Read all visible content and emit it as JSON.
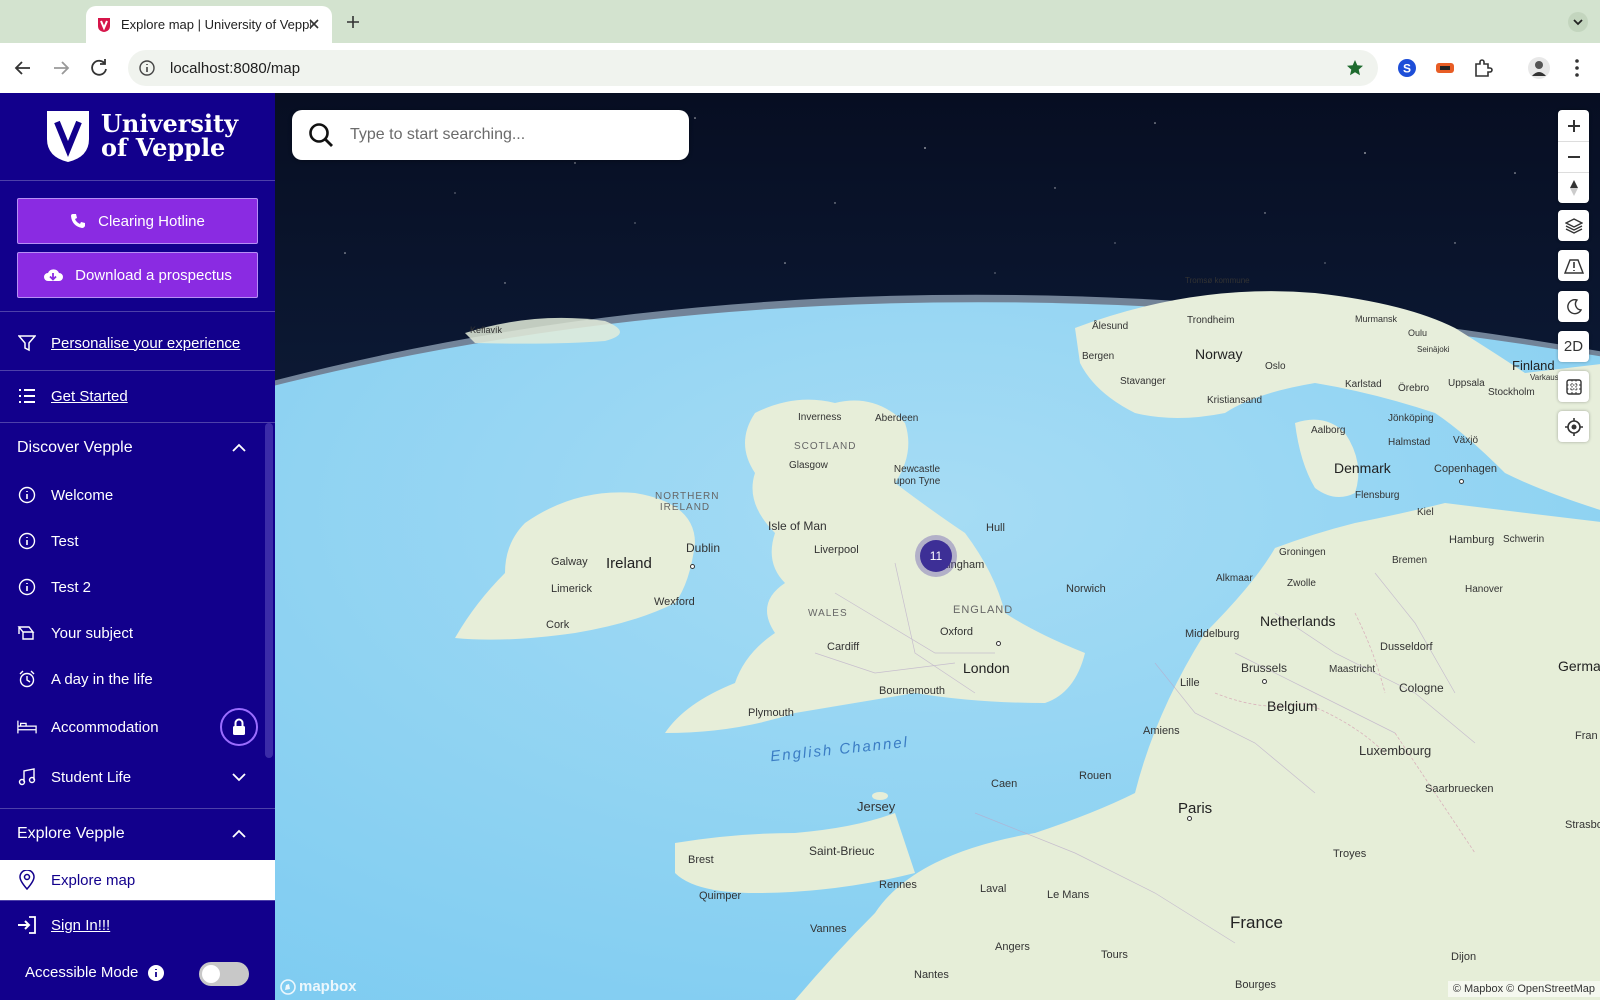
{
  "browser": {
    "tab_title": "Explore map | University of Vepple",
    "url": "localhost:8080/map"
  },
  "sidebar": {
    "logo_line1": "University",
    "logo_line2": "of Vepple",
    "clearing_hotline": "Clearing Hotline",
    "download_prospectus": "Download a prospectus",
    "personalise": "Personalise your experience",
    "get_started": "Get Started",
    "discover_heading": "Discover Vepple",
    "discover_items": [
      "Welcome",
      "Test",
      "Test 2",
      "Your subject",
      "A day in the life",
      "Accommodation",
      "Student Life"
    ],
    "explore_heading": "Explore Vepple",
    "explore_map": "Explore map",
    "sign_in": "Sign In!!!",
    "accessible_mode": "Accessible Mode",
    "accessible_mode_on": false
  },
  "map": {
    "search_placeholder": "Type to start searching...",
    "view_mode": "2D",
    "cluster_count": "11",
    "attribution": "© Mapbox © OpenStreetMap",
    "logo": "mapbox",
    "labels": {
      "keflavik": "Keflavík",
      "alesund": "Ålesund",
      "trondheim": "Trondheim",
      "tromso": "Tromsø kommune",
      "murmansk": "Murmansk",
      "oulu": "Oulu",
      "seinajoki": "Seinäjoki",
      "bergen": "Bergen",
      "norway": "Norway",
      "oslo": "Oslo",
      "stavanger": "Stavanger",
      "kristiansand": "Kristiansand",
      "karlstad": "Karlstad",
      "orebro": "Örebro",
      "uppsala": "Uppsala",
      "stockholm": "Stockholm",
      "finland": "Finland",
      "varkaus": "Varkaus",
      "jonkoping": "Jönköping",
      "aalborg": "Aalborg",
      "halmstad": "Halmstad",
      "vaxjo": "Växjö",
      "denmark": "Denmark",
      "copenhagen": "Copenhagen",
      "flensburg": "Flensburg",
      "kiel": "Kiel",
      "hamburg": "Hamburg",
      "schwerin": "Schwerin",
      "groningen": "Groningen",
      "bremen": "Bremen",
      "alkmaar": "Alkmaar",
      "zwolle": "Zwolle",
      "hanover": "Hanover",
      "netherlands": "Netherlands",
      "middelburg": "Middelburg",
      "dusseldorf": "Dusseldorf",
      "brussels": "Brussels",
      "maastricht": "Maastricht",
      "cologne": "Cologne",
      "germany": "Germa",
      "lille": "Lille",
      "belgium": "Belgium",
      "amiens": "Amiens",
      "luxembourg": "Luxembourg",
      "saarbrucken": "Saarbruecken",
      "frankfurt": "Fran",
      "strasbourg": "Strasbo",
      "rouen": "Rouen",
      "paris": "Paris",
      "caen": "Caen",
      "troyes": "Troyes",
      "inverness": "Inverness",
      "aberdeen": "Aberdeen",
      "scotland": "SCOTLAND",
      "glasgow": "Glasgow",
      "newcastle": "Newcastle upon Tyne",
      "northern_ireland": "NORTHERN IRELAND",
      "isle_of_man": "Isle of Man",
      "hull": "Hull",
      "galway": "Galway",
      "ireland": "Ireland",
      "dublin": "Dublin",
      "liverpool": "Liverpool",
      "nottingham": "Nottingham",
      "limerick": "Limerick",
      "wexford": "Wexford",
      "cork": "Cork",
      "norwich": "Norwich",
      "wales": "WALES",
      "england": "ENGLAND",
      "oxford": "Oxford",
      "cardiff": "Cardiff",
      "london": "London",
      "bournemouth": "Bournemouth",
      "plymouth": "Plymouth",
      "english_channel": "English Channel",
      "jersey": "Jersey",
      "brest": "Brest",
      "saint_brieuc": "Saint-Brieuc",
      "quimper": "Quimper",
      "rennes": "Rennes",
      "laval": "Laval",
      "le_mans": "Le Mans",
      "france": "France",
      "vannes": "Vannes",
      "angers": "Angers",
      "tours": "Tours",
      "dijon": "Dijon",
      "nantes": "Nantes",
      "bourges": "Bourges"
    }
  },
  "colors": {
    "sidebar_bg": "#12008c",
    "cta_bg": "#8a2be2",
    "ocean": "#8dd4f5",
    "land": "#e8efda"
  }
}
